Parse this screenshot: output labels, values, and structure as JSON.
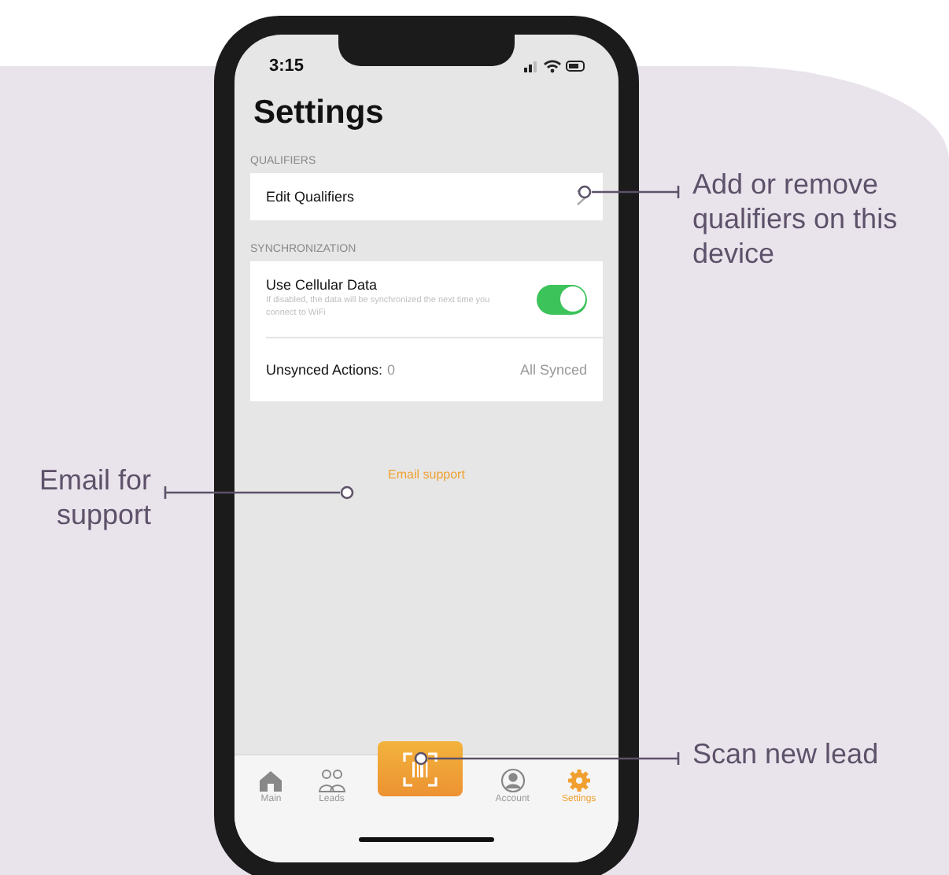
{
  "status_bar": {
    "time": "3:15"
  },
  "title": "Settings",
  "sections": [
    {
      "header": "QUALIFIERS",
      "rows": [
        {
          "kind": "link",
          "label": "Edit Qualifiers"
        }
      ]
    },
    {
      "header": "SYNCHRONIZATION",
      "rows": [
        {
          "kind": "toggle",
          "label": "Use Cellular Data",
          "hint": "If disabled, the data will be synchronized the next time you connect to WiFi",
          "on": true
        },
        {
          "kind": "status",
          "label": "Unsynced Actions:",
          "value": "0",
          "status": "All Synced"
        }
      ]
    }
  ],
  "email_link": "Email support",
  "tabs": [
    {
      "kind": "tab",
      "label": "Main",
      "selected": false
    },
    {
      "kind": "tab",
      "label": "Leads",
      "selected": false
    },
    {
      "kind": "scan",
      "selected": false
    },
    {
      "kind": "tab",
      "label": "Account",
      "selected": false
    },
    {
      "kind": "tab",
      "label": "Settings",
      "selected": true
    }
  ],
  "callouts": [
    {
      "text": "Add or remove qualifiers on this device"
    },
    {
      "text": "Email for support"
    },
    {
      "text": "Scan new lead"
    }
  ]
}
